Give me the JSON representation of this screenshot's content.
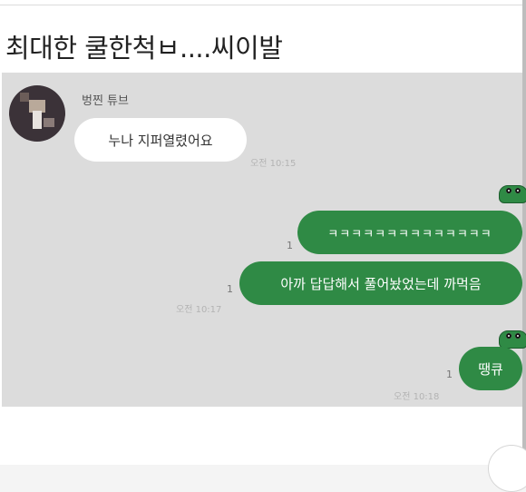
{
  "post": {
    "title": "최대한 쿨한척ㅂ....씨이발"
  },
  "chat": {
    "sender_name": "벙찐 튜브",
    "messages": [
      {
        "direction": "in",
        "text": "누나 지퍼열렸어요",
        "time": "오전 10:15"
      },
      {
        "direction": "out",
        "text": "ㅋㅋㅋㅋㅋㅋㅋㅋㅋㅋㅋㅋㅋㅋ",
        "read_count": "1"
      },
      {
        "direction": "out",
        "text": "아까 답답해서 풀어놨었는데 까먹음",
        "read_count": "1",
        "time": "오전 10:17"
      },
      {
        "direction": "out",
        "text": "땡큐",
        "read_count": "1",
        "time": "오전 10:18"
      }
    ]
  },
  "colors": {
    "chat_background": "#dcdcdc",
    "outgoing_bubble": "#2f8a45",
    "incoming_bubble": "#ffffff"
  },
  "icons": [
    "avatar",
    "frog-sticker-icon"
  ]
}
